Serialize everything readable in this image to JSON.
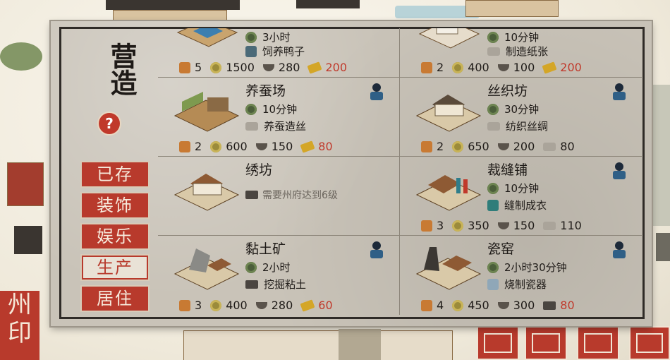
{
  "sidebar": {
    "title": "营造",
    "help_label": "?",
    "categories": [
      {
        "label": "已存",
        "active": false
      },
      {
        "label": "装饰",
        "active": false
      },
      {
        "label": "娱乐",
        "active": false
      },
      {
        "label": "生产",
        "active": true
      },
      {
        "label": "居住",
        "active": false
      }
    ]
  },
  "seal": {
    "text": "州印"
  },
  "buildings": [
    {
      "name": "",
      "duration": "3小时",
      "product": "饲养鸭子",
      "product_icon": "fish-icon",
      "costs": {
        "workers": "5",
        "coins": "1500",
        "food": "280",
        "tickets": "200"
      }
    },
    {
      "name": "",
      "duration": "10分钟",
      "product": "制造纸张",
      "product_icon": "paper-icon",
      "costs": {
        "workers": "2",
        "coins": "400",
        "food": "100",
        "tickets": "200"
      }
    },
    {
      "name": "养蚕场",
      "duration": "10分钟",
      "product": "养蚕造丝",
      "product_icon": "silkworm-icon",
      "costs": {
        "workers": "2",
        "coins": "600",
        "food": "150",
        "tickets": "80"
      }
    },
    {
      "name": "丝织坊",
      "duration": "30分钟",
      "product": "纺织丝绸",
      "product_icon": "silk-icon",
      "costs": {
        "workers": "2",
        "coins": "650",
        "food": "200",
        "material": "80"
      }
    },
    {
      "name": "绣坊",
      "locked_text": "需要州府达到6级"
    },
    {
      "name": "裁缝铺",
      "duration": "10分钟",
      "product": "缝制成衣",
      "product_icon": "clothes-icon",
      "costs": {
        "workers": "3",
        "coins": "350",
        "food": "150",
        "material": "110"
      }
    },
    {
      "name": "黏土矿",
      "duration": "2小时",
      "product": "挖掘粘土",
      "product_icon": "clay-icon",
      "costs": {
        "workers": "3",
        "coins": "400",
        "food": "280",
        "tickets": "60"
      }
    },
    {
      "name": "瓷窑",
      "duration": "2小时30分钟",
      "product": "烧制瓷器",
      "product_icon": "porcelain-icon",
      "costs": {
        "workers": "4",
        "coins": "450",
        "food": "300",
        "material": "80"
      }
    }
  ],
  "colors": {
    "accent_red": "#b83a2c",
    "panel": "#c9c3b8"
  }
}
